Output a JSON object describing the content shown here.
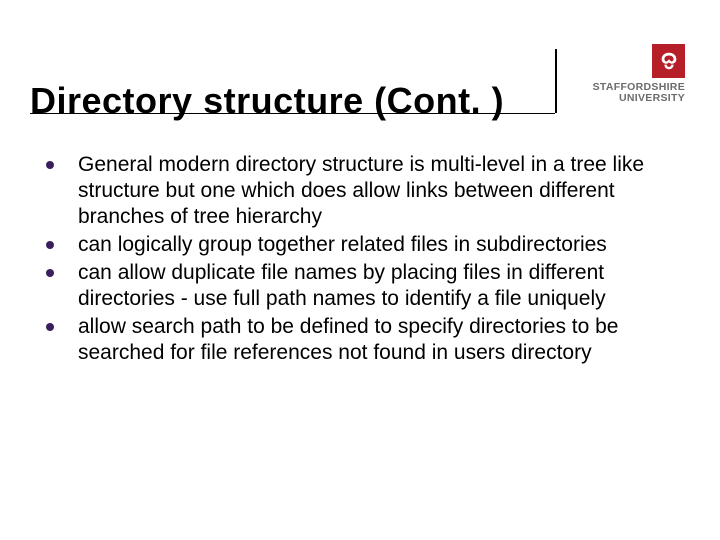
{
  "slide": {
    "title": "Directory structure (Cont. )",
    "logo": {
      "line1": "STAFFORDSHIRE",
      "line2": "UNIVERSITY"
    },
    "bullets": [
      "General modern directory structure is multi-level in a tree like structure but one which does allow links between different branches of tree hierarchy",
      "can logically group together related files in subdirectories",
      "can allow duplicate file names by placing files in different directories - use full path names to identify a file uniquely",
      "allow search path to be defined to specify directories to be searched for file references not found in users directory"
    ]
  }
}
